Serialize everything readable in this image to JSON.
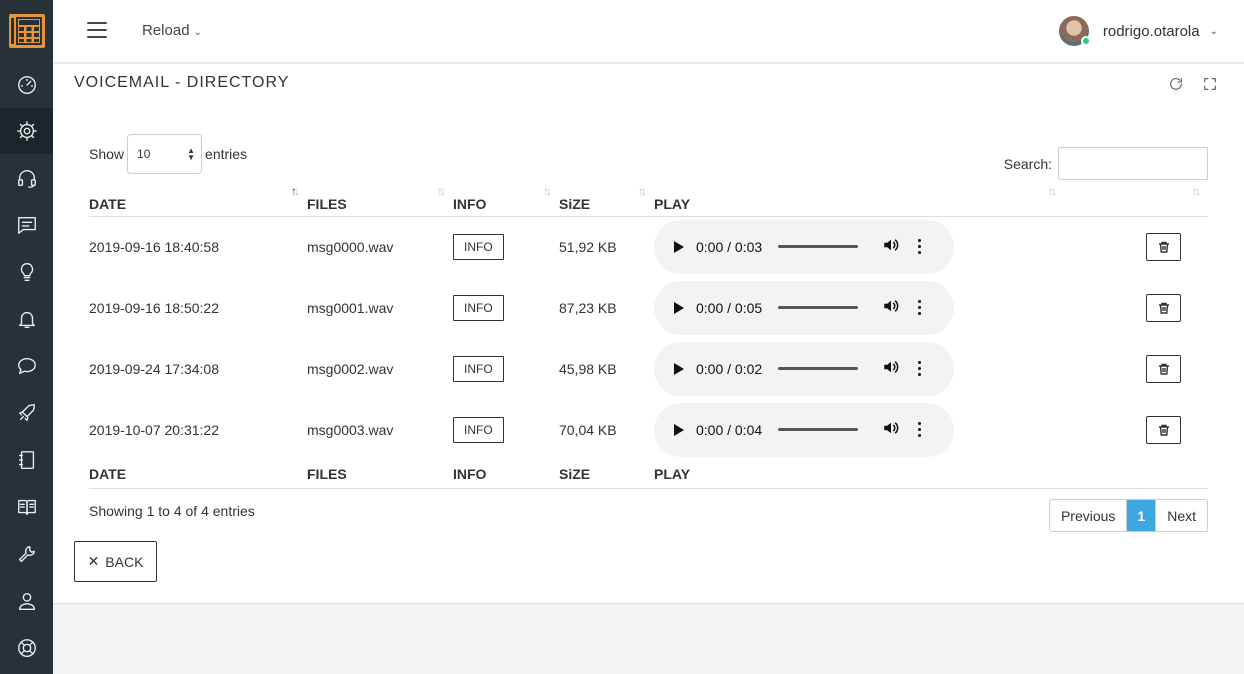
{
  "header": {
    "reload_label": "Reload",
    "username": "rodrigo.otarola",
    "status_color": "#2ecc71"
  },
  "sidebar": {
    "icons": [
      "calculator-logo-icon",
      "dashboard-icon",
      "gear-icon",
      "headset-icon",
      "message-icon",
      "lightbulb-icon",
      "bell-icon",
      "chat-icon",
      "rocket-icon",
      "notebook-icon",
      "book-icon",
      "wrench-icon",
      "user-icon",
      "lifebuoy-icon"
    ],
    "active": "gear-icon",
    "accent_color": "#e8943a"
  },
  "panel": {
    "title": "VOICEMAIL - DIRECTORY"
  },
  "table_controls": {
    "show_label": "Show",
    "entries_label": "entries",
    "page_length": "10",
    "search_label": "Search:",
    "search_value": ""
  },
  "table": {
    "columns": [
      "DATE",
      "FILES",
      "INFO",
      "SiZE",
      "PLAY"
    ],
    "info_label": "INFO",
    "rows": [
      {
        "date": "2019-09-16 18:40:58",
        "file": "msg0000.wav",
        "size": "51,92 KB",
        "time": "0:00 / 0:03"
      },
      {
        "date": "2019-09-16 18:50:22",
        "file": "msg0001.wav",
        "size": "87,23 KB",
        "time": "0:00 / 0:05"
      },
      {
        "date": "2019-09-24 17:34:08",
        "file": "msg0002.wav",
        "size": "45,98 KB",
        "time": "0:00 / 0:02"
      },
      {
        "date": "2019-10-07 20:31:22",
        "file": "msg0003.wav",
        "size": "70,04 KB",
        "time": "0:00 / 0:04"
      }
    ]
  },
  "footer": {
    "showing_text": "Showing 1 to 4 of 4 entries",
    "previous_label": "Previous",
    "current_page": "1",
    "next_label": "Next",
    "pagination_accent": "#3ea8de",
    "back_label": "BACK"
  }
}
